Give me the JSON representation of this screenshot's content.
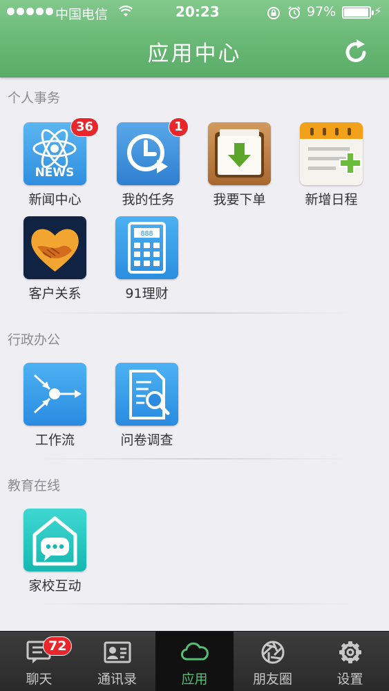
{
  "status_bar": {
    "carrier": "中国电信",
    "time": "20:23",
    "battery": "97%",
    "battery_level": 0.97
  },
  "header": {
    "title": "应用中心",
    "refresh_icon": "refresh-icon"
  },
  "sections": [
    {
      "title": "个人事务",
      "apps": [
        {
          "label": "新闻中心",
          "icon": "news-icon",
          "badge": "36"
        },
        {
          "label": "我的任务",
          "icon": "task-clock-icon",
          "badge": "1"
        },
        {
          "label": "我要下单",
          "icon": "download-folder-icon",
          "badge": ""
        },
        {
          "label": "新增日程",
          "icon": "calendar-add-icon",
          "badge": ""
        },
        {
          "label": "客户关系",
          "icon": "handshake-heart-icon",
          "badge": ""
        },
        {
          "label": "91理财",
          "icon": "calculator-icon",
          "badge": ""
        }
      ]
    },
    {
      "title": "行政办公",
      "apps": [
        {
          "label": "工作流",
          "icon": "workflow-icon",
          "badge": ""
        },
        {
          "label": "问卷调查",
          "icon": "survey-search-icon",
          "badge": ""
        }
      ]
    },
    {
      "title": "教育在线",
      "apps": [
        {
          "label": "家校互动",
          "icon": "home-chat-icon",
          "badge": ""
        }
      ]
    }
  ],
  "tabbar": {
    "tabs": [
      {
        "label": "聊天",
        "icon": "chat-icon",
        "badge": "72",
        "active": false
      },
      {
        "label": "通讯录",
        "icon": "contacts-icon",
        "badge": "",
        "active": false
      },
      {
        "label": "应用",
        "icon": "cloud-icon",
        "badge": "",
        "active": true
      },
      {
        "label": "朋友圈",
        "icon": "aperture-icon",
        "badge": "",
        "active": false
      },
      {
        "label": "设置",
        "icon": "gear-icon",
        "badge": "",
        "active": false
      }
    ]
  },
  "colors": {
    "header_green": "#6cbb78",
    "active_tab_green": "#53c074",
    "badge_red": "#e8262c"
  }
}
